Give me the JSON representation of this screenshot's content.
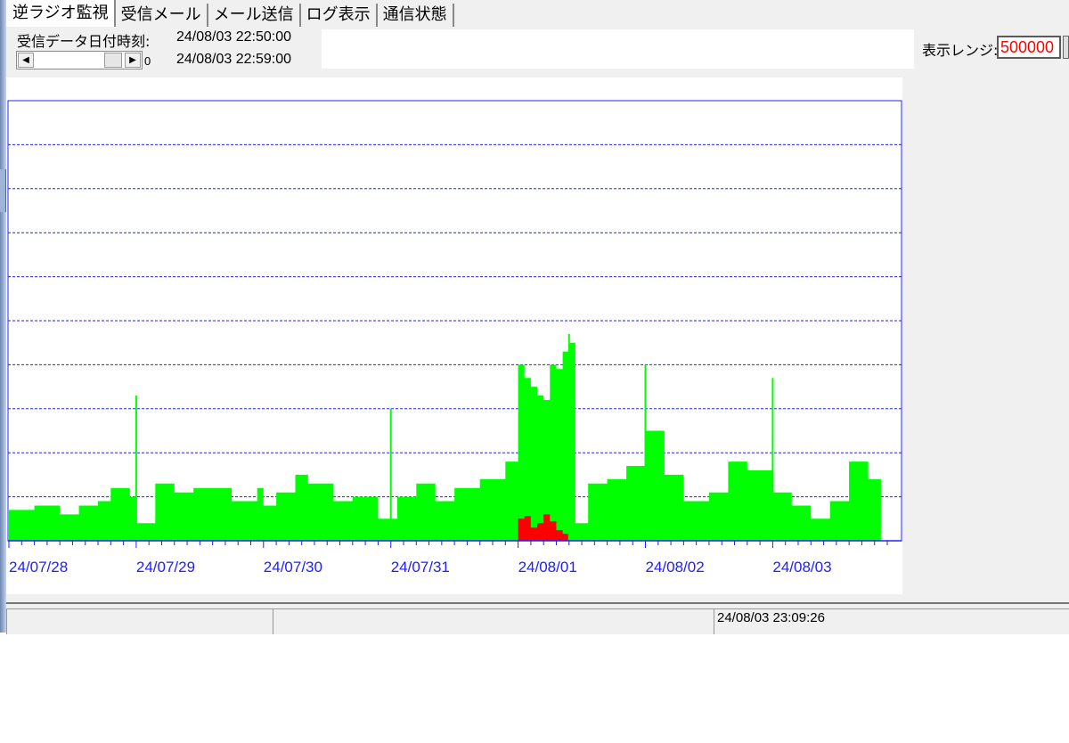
{
  "tabs": [
    "逆ラジオ監視",
    "受信メール",
    "メール送信",
    "ログ表示",
    "通信状態"
  ],
  "receive": {
    "label": "受信データ日付時刻:",
    "time_start": "24/08/03 22:50:00",
    "time_end": "24/08/03 22:59:00",
    "slider_value": "0"
  },
  "display_range": {
    "label": "表示レンジ:",
    "value": "500000"
  },
  "status_bar": {
    "time": "24/08/03 23:09:26"
  },
  "colors": {
    "series_primary": "#00ff00",
    "series_alert": "#ff0000",
    "axis": "#2020ff",
    "range_text": "#ff0000"
  },
  "icons": [
    "scroll-left-icon",
    "scroll-right-icon"
  ],
  "chart_data": {
    "type": "area",
    "x_tick_labels": [
      "24/07/28",
      "24/07/29",
      "24/07/30",
      "24/07/31",
      "24/08/01",
      "24/08/02",
      "24/08/03"
    ],
    "ylim": [
      0,
      500000
    ],
    "grid": "horizontal dashed",
    "series": [
      {
        "color": "#00ff00",
        "x_days": [
          0.0,
          0.2,
          0.4,
          0.55,
          0.7,
          0.8,
          0.95,
          1.0,
          1.15,
          1.3,
          1.45,
          1.6,
          1.75,
          1.95,
          2.0,
          2.1,
          2.25,
          2.35,
          2.55,
          2.7,
          2.9,
          3.05,
          3.2,
          3.35,
          3.5,
          3.7,
          3.9,
          4.0,
          4.05,
          4.1,
          4.15,
          4.2,
          4.25,
          4.3,
          4.35,
          4.4,
          4.45,
          4.55,
          4.7,
          4.85,
          5.0,
          5.15,
          5.3,
          5.5,
          5.65,
          5.8,
          6.0,
          6.15,
          6.3,
          6.45,
          6.6,
          6.75,
          6.85
        ],
        "y": [
          35000,
          40000,
          30000,
          40000,
          45000,
          60000,
          50000,
          20000,
          65000,
          55000,
          60000,
          60000,
          45000,
          60000,
          40000,
          55000,
          75000,
          65000,
          45000,
          50000,
          25000,
          50000,
          65000,
          45000,
          60000,
          70000,
          90000,
          200000,
          185000,
          175000,
          165000,
          160000,
          200000,
          195000,
          215000,
          225000,
          20000,
          65000,
          70000,
          85000,
          125000,
          75000,
          45000,
          55000,
          90000,
          80000,
          55000,
          40000,
          25000,
          45000,
          90000,
          70000,
          55000
        ]
      },
      {
        "color": "#ff0000",
        "x_days": [
          4.0,
          4.05,
          4.1,
          4.15,
          4.2,
          4.25,
          4.3,
          4.35,
          4.4
        ],
        "y": [
          25000,
          28000,
          15000,
          20000,
          30000,
          22000,
          12000,
          8000,
          5000
        ]
      }
    ],
    "spikes": [
      {
        "x_day": 1.0,
        "y": 165000
      },
      {
        "x_day": 3.0,
        "y": 150000
      },
      {
        "x_day": 4.4,
        "y": 235000
      },
      {
        "x_day": 5.0,
        "y": 200000
      },
      {
        "x_day": 6.0,
        "y": 185000
      }
    ]
  }
}
